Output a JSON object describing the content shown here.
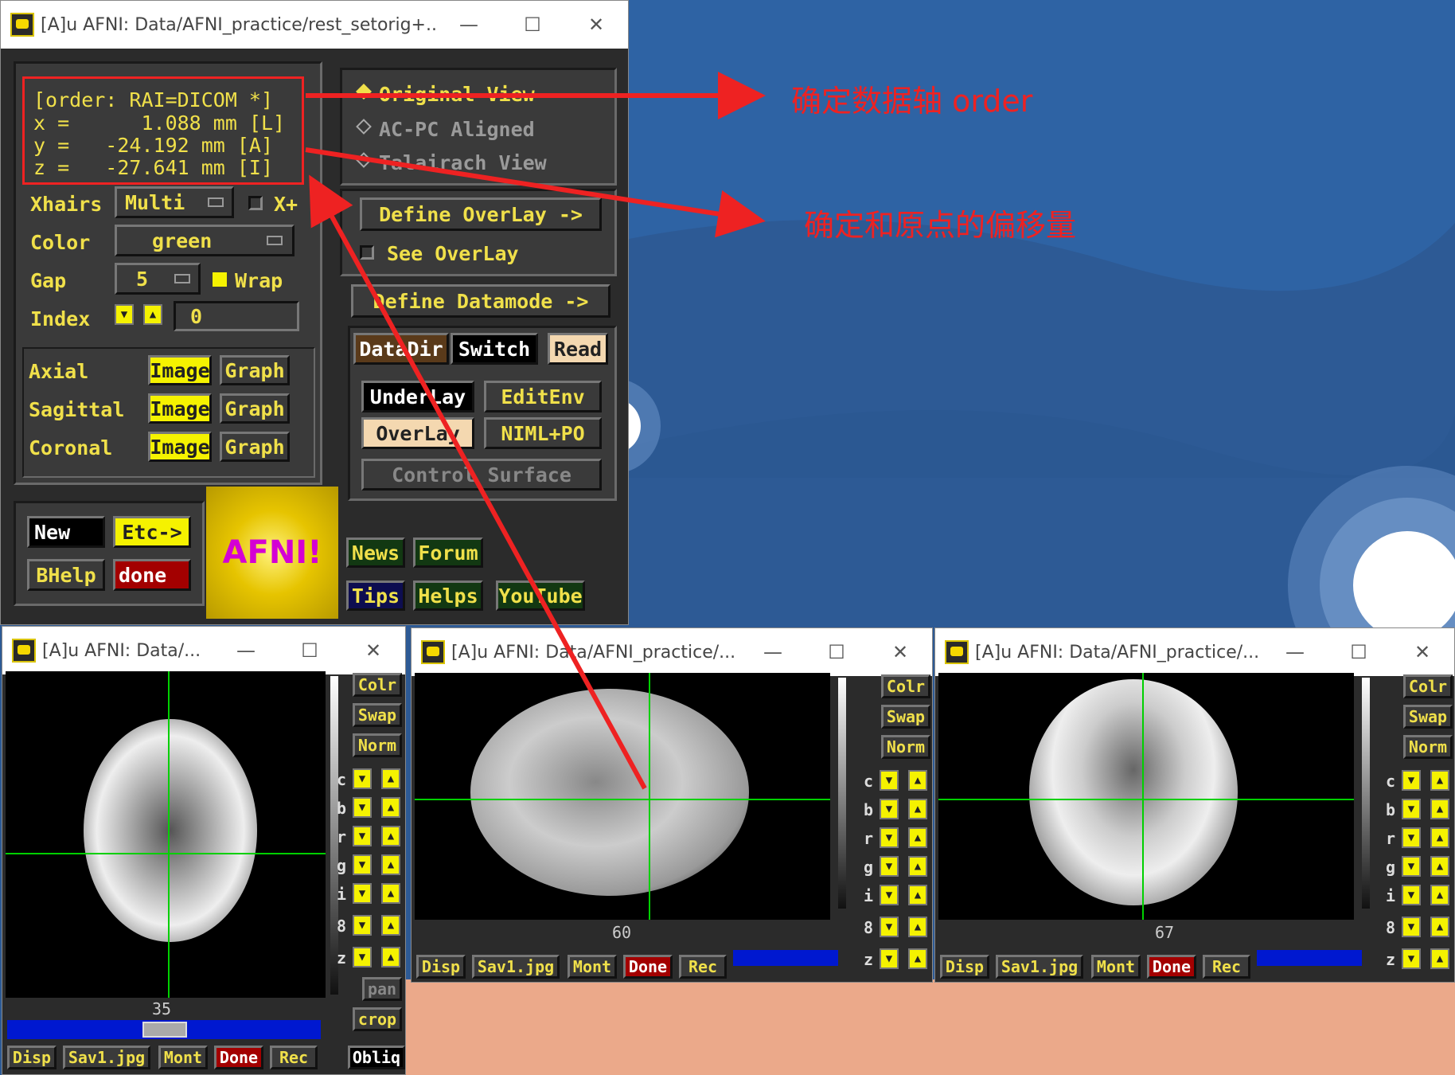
{
  "desktop": {
    "bg": "#2d5a95",
    "accent": "#eba98a"
  },
  "main_window": {
    "title": "[A]u AFNI: Data/AFNI_practice/rest_setorig+...",
    "coords": {
      "order": "[order: RAI=DICOM *]",
      "x": "x =      1.088 mm [L]",
      "y": "y =   -24.192 mm [A]",
      "z": "z =   -27.641 mm [I]"
    },
    "xhairs": {
      "label": "Xhairs",
      "value": "Multi",
      "xplus": "X+"
    },
    "color": {
      "label": "Color",
      "value": "green"
    },
    "gap": {
      "label": "Gap",
      "value": "5",
      "wrap": "Wrap"
    },
    "index": {
      "label": "Index",
      "value": "0"
    },
    "views": [
      {
        "label": "Axial",
        "image": "Image",
        "graph": "Graph"
      },
      {
        "label": "Sagittal",
        "image": "Image",
        "graph": "Graph"
      },
      {
        "label": "Coronal",
        "image": "Image",
        "graph": "Graph"
      }
    ],
    "new": "New",
    "etc": "Etc->",
    "bhelp": "BHelp",
    "done": "done",
    "logo": "AFNI!",
    "view_modes": [
      "Original View",
      "AC-PC Aligned",
      "Talairach View"
    ],
    "define_overlay": "Define OverLay ->",
    "see_overlay": "See OverLay",
    "define_datamode": "Define Datamode ->",
    "datadir": "DataDir",
    "switch": "Switch",
    "read": "Read",
    "underlay": "UnderLay",
    "editenv": "EditEnv",
    "overlay": "OverLay",
    "niml": "NIML+PO",
    "control_surface": "Control Surface",
    "news": "News",
    "forum": "Forum",
    "tips": "Tips",
    "helps": "Helps",
    "youtube": "YouTube"
  },
  "image_windows": [
    {
      "title": "[A]u AFNI: Data/...",
      "slice": "35"
    },
    {
      "title": "[A]u AFNI: Data/AFNI_practice/...",
      "slice": "60"
    },
    {
      "title": "[A]u AFNI: Data/AFNI_practice/...",
      "slice": "67"
    }
  ],
  "side_buttons": {
    "colr": "Colr",
    "swap": "Swap",
    "norm": "Norm",
    "letters": [
      "c",
      "b",
      "r",
      "g",
      "i",
      "8",
      "z"
    ],
    "pan": "pan",
    "crop": "crop",
    "obliq": "Obliq"
  },
  "bottom_buttons": {
    "disp": "Disp",
    "sav": "Sav1.jpg",
    "mont": "Mont",
    "done": "Done",
    "rec": "Rec"
  },
  "annotations": {
    "order": "确定数据轴 order",
    "offset": "确定和原点的偏移量"
  },
  "colors": {
    "crosshair": "#00d000",
    "annot": "#ee2222"
  }
}
